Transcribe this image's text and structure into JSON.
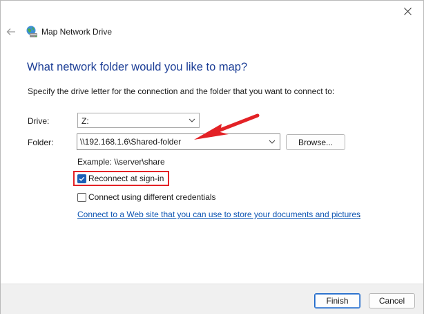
{
  "window": {
    "title": "Map Network Drive",
    "icons": {
      "back": "back-arrow-icon",
      "app": "network-drive-icon",
      "close": "close-icon"
    }
  },
  "main": {
    "heading": "What network folder would you like to map?",
    "instructions": "Specify the drive letter for the connection and the folder that you want to connect to:",
    "drive": {
      "label": "Drive:",
      "value": "Z:"
    },
    "folder": {
      "label": "Folder:",
      "value": "\\\\192.168.1.6\\Shared-folder"
    },
    "browse_label": "Browse...",
    "example": "Example: \\\\server\\share",
    "reconnect": {
      "label": "Reconnect at sign-in",
      "checked": true
    },
    "different_credentials": {
      "label": "Connect using different credentials",
      "checked": false
    },
    "link_text": "Connect to a Web site that you can use to store your documents and pictures",
    "link_suffix": "."
  },
  "footer": {
    "finish_label": "Finish",
    "cancel_label": "Cancel"
  },
  "colors": {
    "accent": "#1c5fb6",
    "heading": "#1c3e96",
    "link": "#0f56b3",
    "annotation": "#e32226"
  }
}
